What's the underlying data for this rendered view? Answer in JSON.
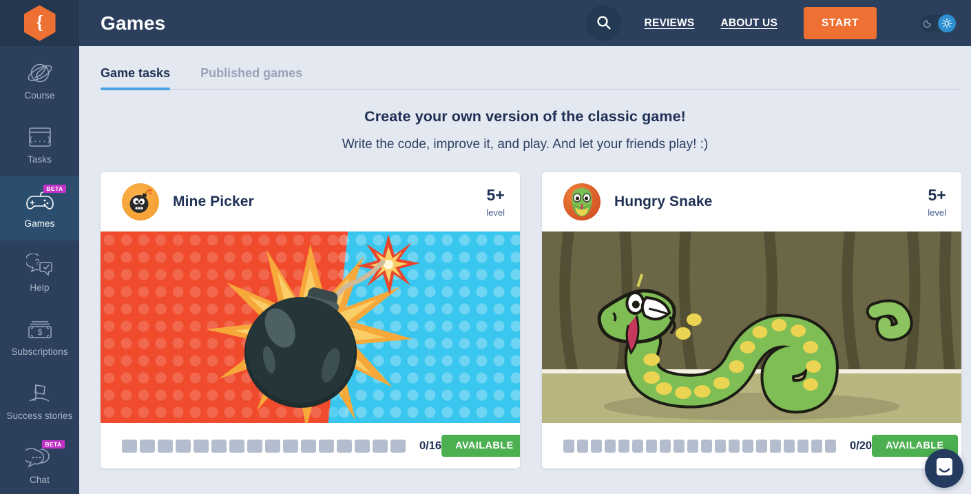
{
  "brand": {
    "logo_icon": "curly-brace-hexagon-logo",
    "accent": "#ef7033"
  },
  "sidebar": {
    "items": [
      {
        "label": "Course",
        "icon": "rocket-planet-icon",
        "badge": null,
        "active": false
      },
      {
        "label": "Tasks",
        "icon": "code-window-icon",
        "badge": null,
        "active": false
      },
      {
        "label": "Games",
        "icon": "gamepad-icon",
        "badge": "BETA",
        "active": true
      },
      {
        "label": "Help",
        "icon": "question-bubble-icon",
        "badge": null,
        "active": false
      },
      {
        "label": "Subscriptions",
        "icon": "money-dollar-icon",
        "badge": null,
        "active": false
      },
      {
        "label": "Success stories",
        "icon": "flag-hill-icon",
        "badge": null,
        "active": false
      },
      {
        "label": "Chat",
        "icon": "chat-bubbles-icon",
        "badge": "BETA",
        "active": false
      }
    ]
  },
  "header": {
    "title": "Games",
    "search_icon": "search-icon",
    "links": [
      {
        "label": "REVIEWS"
      },
      {
        "label": "ABOUT US"
      }
    ],
    "start_label": "START",
    "theme_toggle": {
      "dark_icon": "moon-icon",
      "light_icon": "sun-icon",
      "active": "light"
    }
  },
  "tabs": [
    {
      "label": "Game tasks",
      "active": true
    },
    {
      "label": "Published games",
      "active": false
    }
  ],
  "headline": {
    "title": "Create your own version of the classic game!",
    "subtitle": "Write the code, improve it, and play. And let your friends play! :)"
  },
  "cards": [
    {
      "name": "Mine Picker",
      "avatar_icon": "bomb-avatar-icon",
      "art_icon": "bomb-explosion-artwork",
      "level_value": "5+",
      "level_label": "level",
      "pips_total": 16,
      "pips_done": 0,
      "progress_text": "0/16",
      "status_label": "AVAILABLE",
      "status_color": "#4caf50"
    },
    {
      "name": "Hungry Snake",
      "avatar_icon": "snake-avatar-icon",
      "art_icon": "green-snake-artwork",
      "level_value": "5+",
      "level_label": "level",
      "pips_total": 20,
      "pips_done": 0,
      "progress_text": "0/20",
      "status_label": "AVAILABLE",
      "status_color": "#4caf50"
    }
  ],
  "chat_widget": {
    "icon": "intercom-chat-icon"
  }
}
